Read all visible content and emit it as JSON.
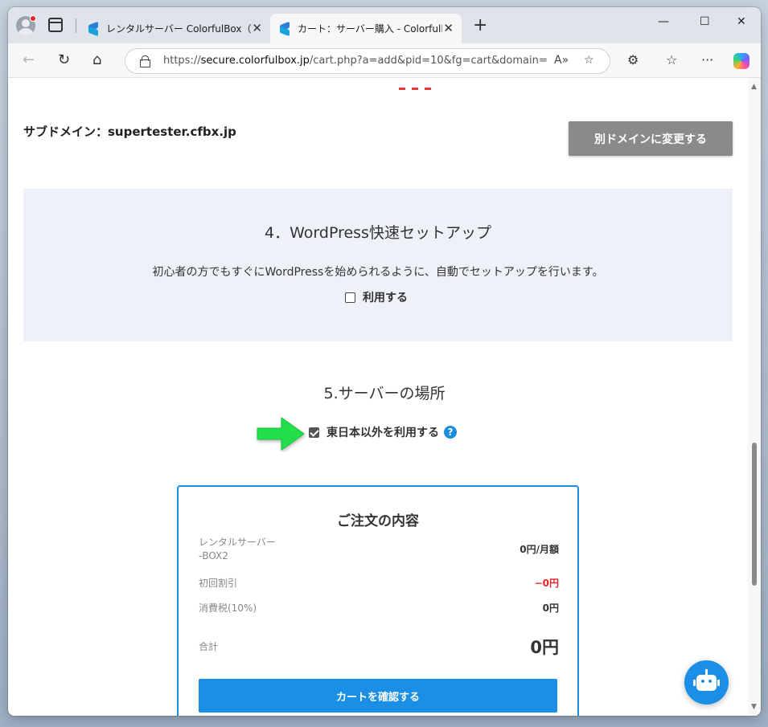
{
  "browser": {
    "tabs": [
      {
        "title": "レンタルサーバー ColorfulBox（カラフル"
      },
      {
        "title": "カート：サーバー購入 - ColorfulBox"
      }
    ],
    "url": {
      "prefix": "https://",
      "host": "secure.colorfulbox.jp",
      "path": "/cart.php?a=add&pid=10&fg=cart&domain="
    }
  },
  "page": {
    "subdomain_label": "サブドメイン：supertester.cfbx.jp",
    "change_domain_button": "別ドメインに変更する",
    "section4": {
      "title": "4．WordPress快速セットアップ",
      "description": "初心者の方でもすぐにWordPressを始められるように、自動でセットアップを行います。",
      "checkbox_label": "利用する",
      "checked": false
    },
    "section5": {
      "title": "5.サーバーの場所",
      "checkbox_label": "東日本以外を利用する",
      "checked": true,
      "help_icon": "?"
    },
    "order": {
      "title": "ご注文の内容",
      "rows": [
        {
          "label_line1": "レンタルサーバー",
          "label_line2": "-BOX2",
          "value": "0円/月額"
        },
        {
          "label": "初回割引",
          "value": "−0円"
        },
        {
          "label": "消費税(10%)",
          "value": "0円"
        },
        {
          "label": "合計",
          "value": "0円"
        }
      ],
      "confirm_button": "カートを確認する"
    }
  },
  "colors": {
    "accent": "#1b8fe6",
    "discount_red": "#e3262b",
    "arrow_green": "#22e04a"
  }
}
